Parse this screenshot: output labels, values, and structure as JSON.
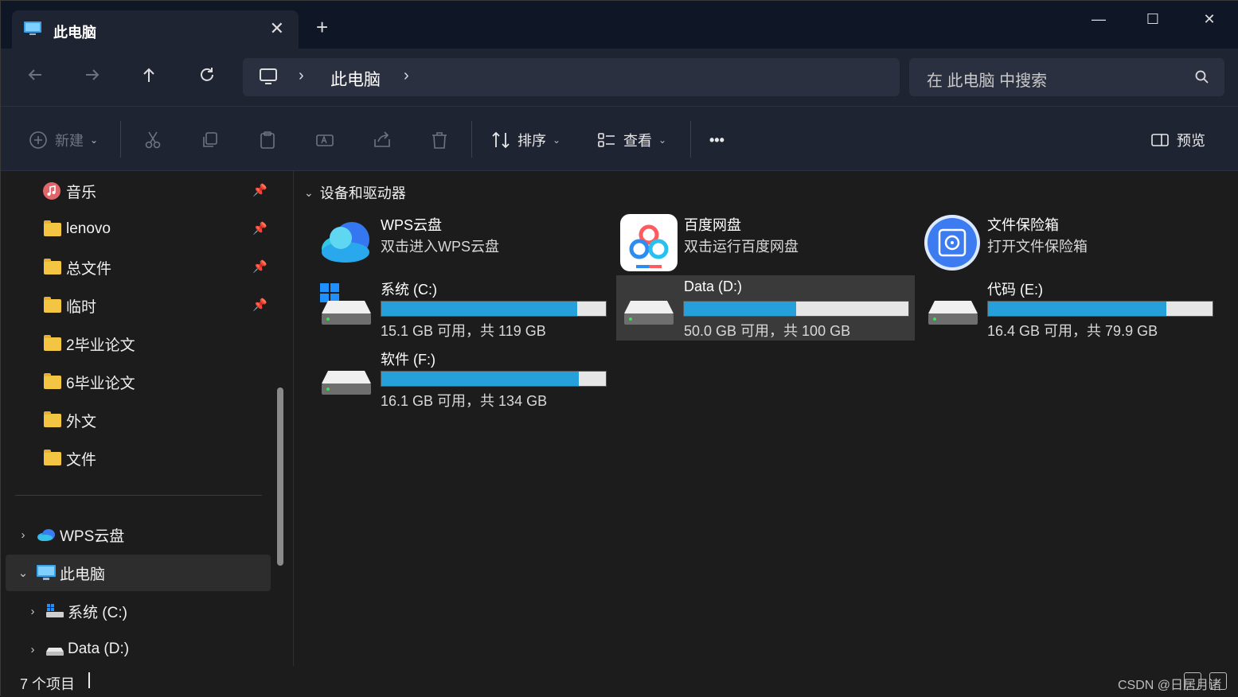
{
  "titlebar": {
    "tab_title": "此电脑",
    "tab_close": "✕",
    "new_tab": "+",
    "minimize": "—",
    "maximize": "☐",
    "close": "✕"
  },
  "nav": {
    "back_icon": "arrow-left-icon",
    "forward_icon": "arrow-right-icon",
    "up_icon": "arrow-up-icon",
    "refresh_icon": "refresh-icon",
    "breadcrumb": [
      "此电脑"
    ],
    "search_placeholder": "在 此电脑 中搜索"
  },
  "toolbar": {
    "new_label": "新建",
    "sort_label": "排序",
    "view_label": "查看",
    "more_label": "•••",
    "preview_label": "预览"
  },
  "sidebar": {
    "items": [
      {
        "label": "音乐",
        "icon": "music-icon",
        "pinned": true
      },
      {
        "label": "lenovo",
        "icon": "folder-icon",
        "pinned": true
      },
      {
        "label": "总文件",
        "icon": "folder-icon",
        "pinned": true
      },
      {
        "label": "临时",
        "icon": "folder-icon",
        "pinned": true
      },
      {
        "label": "2毕业论文",
        "icon": "folder-icon",
        "pinned": false
      },
      {
        "label": "6毕业论文",
        "icon": "folder-icon",
        "pinned": false
      },
      {
        "label": "外文",
        "icon": "folder-icon",
        "pinned": false
      },
      {
        "label": "文件",
        "icon": "folder-icon",
        "pinned": false
      }
    ],
    "tree": [
      {
        "label": "WPS云盘",
        "icon": "wps-cloud-icon",
        "expanded": false,
        "selected": false
      },
      {
        "label": "此电脑",
        "icon": "computer-icon",
        "expanded": true,
        "selected": true
      },
      {
        "label": "系统 (C:)",
        "icon": "windows-drive-icon",
        "expanded": false,
        "selected": false
      },
      {
        "label": "Data (D:)",
        "icon": "drive-icon",
        "expanded": false,
        "selected": false
      }
    ]
  },
  "main": {
    "group_header": "设备和驱动器",
    "apps": [
      {
        "name": "WPS云盘",
        "sub": "双击进入WPS云盘",
        "icon": "wps-cloud-icon"
      },
      {
        "name": "百度网盘",
        "sub": "双击运行百度网盘",
        "icon": "baidu-netdisk-icon"
      },
      {
        "name": "文件保险箱",
        "sub": "打开文件保险箱",
        "icon": "vault-icon"
      }
    ],
    "drives": [
      {
        "name": "系统 (C:)",
        "free": "15.1 GB 可用，共 119 GB",
        "used_fraction": 0.873,
        "selected": false
      },
      {
        "name": "Data (D:)",
        "free": "50.0 GB 可用，共 100 GB",
        "used_fraction": 0.5,
        "selected": true
      },
      {
        "name": "代码 (E:)",
        "free": "16.4 GB 可用，共 79.9 GB",
        "used_fraction": 0.795,
        "selected": false
      },
      {
        "name": "软件 (F:)",
        "free": "16.1 GB 可用，共 134 GB",
        "used_fraction": 0.88,
        "selected": false
      }
    ]
  },
  "status": {
    "count": "7 个项目",
    "watermark": "CSDN @日居月诸"
  },
  "colors": {
    "accent": "#26a0da",
    "folder": "#f4c542",
    "titlebar": "#0f1626",
    "chrome": "#1f2433"
  }
}
